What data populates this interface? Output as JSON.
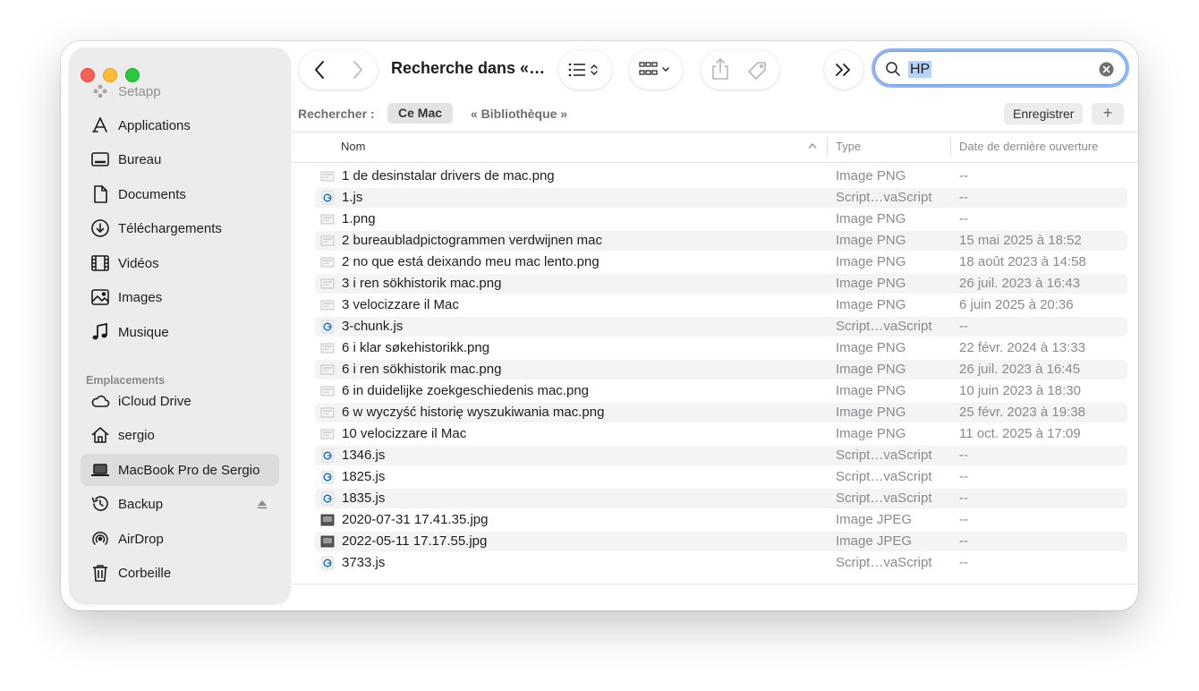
{
  "sidebar": {
    "favorites": [
      {
        "label": "Setapp",
        "icon": "setapp-icon"
      },
      {
        "label": "Applications",
        "icon": "applications-icon"
      },
      {
        "label": "Bureau",
        "icon": "desktop-icon"
      },
      {
        "label": "Documents",
        "icon": "document-icon"
      },
      {
        "label": "Téléchargements",
        "icon": "download-icon"
      },
      {
        "label": "Vidéos",
        "icon": "film-icon"
      },
      {
        "label": "Images",
        "icon": "photo-icon"
      },
      {
        "label": "Musique",
        "icon": "music-note-icon"
      }
    ],
    "locations_title": "Emplacements",
    "locations": [
      {
        "label": "iCloud Drive",
        "icon": "cloud-icon"
      },
      {
        "label": "sergio",
        "icon": "home-icon"
      },
      {
        "label": "MacBook Pro de Sergio",
        "icon": "laptop-icon",
        "selected": true
      },
      {
        "label": "Backup",
        "icon": "time-machine-icon"
      },
      {
        "label": "AirDrop",
        "icon": "airdrop-icon"
      },
      {
        "label": "Corbeille",
        "icon": "trash-icon"
      }
    ]
  },
  "toolbar": {
    "title": "Recherche dans «…",
    "search_value": "HP"
  },
  "scope": {
    "label": "Rechercher :",
    "mac": "Ce Mac",
    "library": "« Bibliothèque »",
    "save": "Enregistrer",
    "plus": "+"
  },
  "columns": {
    "name": "Nom",
    "type": "Type",
    "date": "Date de dernière ouverture"
  },
  "files": [
    {
      "name": "1 de desinstalar drivers de mac.png",
      "type": "Image PNG",
      "date": "--",
      "icon": "png-thumbnail-icon"
    },
    {
      "name": "1.js",
      "type": "Script…vaScript",
      "date": "--",
      "icon": "js-file-icon"
    },
    {
      "name": "1.png",
      "type": "Image PNG",
      "date": "--",
      "icon": "png-thumbnail-icon"
    },
    {
      "name": "2 bureaubladpictogrammen verdwijnen mac",
      "type": "Image PNG",
      "date": "15 mai 2025 à 18:52",
      "icon": "png-thumbnail-icon"
    },
    {
      "name": "2 no que está deixando meu mac lento.png",
      "type": "Image PNG",
      "date": "18 août 2023 à 14:58",
      "icon": "png-thumbnail-icon"
    },
    {
      "name": "3 i ren sökhistorik mac.png",
      "type": "Image PNG",
      "date": "26 juil. 2023 à 16:43",
      "icon": "png-thumbnail-icon"
    },
    {
      "name": "3 velocizzare il Mac",
      "type": "Image PNG",
      "date": "6 juin 2025 à 20:36",
      "icon": "png-thumbnail-icon"
    },
    {
      "name": "3-chunk.js",
      "type": "Script…vaScript",
      "date": "--",
      "icon": "js-file-icon"
    },
    {
      "name": "6 i klar søkehistorikk.png",
      "type": "Image PNG",
      "date": "22 févr. 2024 à 13:33",
      "icon": "png-thumbnail-icon"
    },
    {
      "name": "6 i ren sökhistorik mac.png",
      "type": "Image PNG",
      "date": "26 juil. 2023 à 16:45",
      "icon": "png-thumbnail-icon"
    },
    {
      "name": "6 in duidelijke zoekgeschiedenis mac.png",
      "type": "Image PNG",
      "date": "10 juin 2023 à 18:30",
      "icon": "png-thumbnail-icon"
    },
    {
      "name": "6 w wyczyść historię wyszukiwania mac.png",
      "type": "Image PNG",
      "date": "25 févr. 2023 à 19:38",
      "icon": "png-thumbnail-icon"
    },
    {
      "name": "10 velocizzare il Mac",
      "type": "Image PNG",
      "date": "11 oct. 2025 à 17:09",
      "icon": "png-thumbnail-icon"
    },
    {
      "name": "1346.js",
      "type": "Script…vaScript",
      "date": "--",
      "icon": "js-file-icon"
    },
    {
      "name": "1825.js",
      "type": "Script…vaScript",
      "date": "--",
      "icon": "js-file-icon"
    },
    {
      "name": "1835.js",
      "type": "Script…vaScript",
      "date": "--",
      "icon": "js-file-icon"
    },
    {
      "name": "2020-07-31 17.41.35.jpg",
      "type": "Image JPEG",
      "date": "--",
      "icon": "jpeg-thumbnail-icon"
    },
    {
      "name": "2022-05-11 17.17.55.jpg",
      "type": "Image JPEG",
      "date": "--",
      "icon": "jpeg-thumbnail-icon"
    },
    {
      "name": "3733.js",
      "type": "Script…vaScript",
      "date": "--",
      "icon": "js-file-icon"
    }
  ],
  "colors": {
    "accent": "#3b82f6",
    "close": "#ff5f57",
    "minimize": "#febc2e",
    "maximize": "#28c840"
  }
}
